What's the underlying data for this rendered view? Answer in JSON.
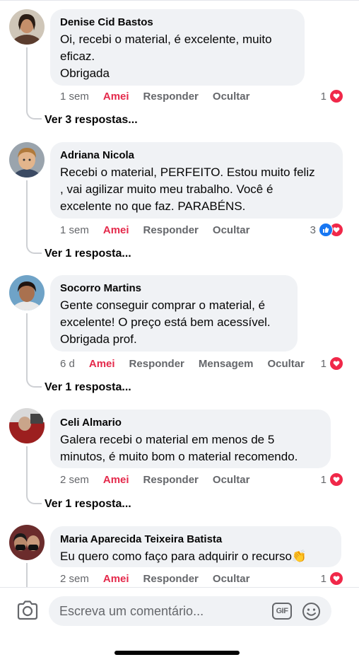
{
  "comments": [
    {
      "author": "Denise Cid Bastos",
      "text": "Oi, recebi o material, é excelente,  muito\neficaz.\nObrigada",
      "time": "1 sem",
      "love_label": "Amei",
      "reply_label": "Responder",
      "hide_label": "Ocultar",
      "reaction_count": "1",
      "replies_link": "Ver 3 respostas..."
    },
    {
      "author": "Adriana Nicola",
      "text": "Recebi o material,  PERFEITO. Estou muito feliz\n, vai agilizar muito meu trabalho.  Você é\nexcelente no que faz. PARABÉNS.",
      "time": "1 sem",
      "love_label": "Amei",
      "reply_label": "Responder",
      "hide_label": "Ocultar",
      "reaction_count": "3",
      "replies_link": "Ver 1 resposta..."
    },
    {
      "author": "Socorro Martins",
      "text": "Gente conseguir comprar o material, é\nexcelente! O preço está bem acessível.\nObrigada prof.",
      "time": "6 d",
      "love_label": "Amei",
      "reply_label": "Responder",
      "message_label": "Mensagem",
      "hide_label": "Ocultar",
      "reaction_count": "1",
      "replies_link": "Ver 1 resposta..."
    },
    {
      "author": "Celi Almario",
      "text": "Galera recebi o material em menos de 5\nminutos, é muito bom o material recomendo.",
      "time": "2 sem",
      "love_label": "Amei",
      "reply_label": "Responder",
      "hide_label": "Ocultar",
      "reaction_count": "1",
      "replies_link": "Ver 1 resposta..."
    },
    {
      "author": "Maria Aparecida Teixeira Batista",
      "text": "Eu quero como faço para adquirir o recurso",
      "emoji": "👏",
      "time": "2 sem",
      "love_label": "Amei",
      "reply_label": "Responder",
      "hide_label": "Ocultar",
      "reaction_count": "1"
    }
  ],
  "composer": {
    "placeholder": "Escreva um comentário...",
    "gif_label": "GIF"
  },
  "colors": {
    "love_accent": "#e4294b",
    "bubble_bg": "#f0f2f5",
    "like_blue": "#1877f2",
    "secondary_text": "#65676b"
  },
  "icons": [
    "camera-icon",
    "gif-icon",
    "emoji-icon",
    "love-reaction-icon",
    "like-reaction-icon"
  ]
}
